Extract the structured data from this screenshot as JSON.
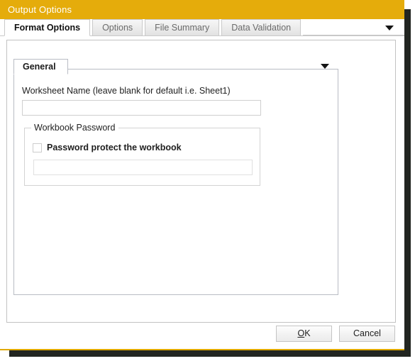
{
  "window": {
    "title": "Output Options",
    "accent_color": "#e5ac0b",
    "background_color": "#ffffff"
  },
  "tabs": [
    {
      "label": "Format Options",
      "active": true
    },
    {
      "label": "Options",
      "active": false
    },
    {
      "label": "File Summary",
      "active": false
    },
    {
      "label": "Data Validation",
      "active": false
    }
  ],
  "tabstrip": {
    "overflow_icon": "chevron-down-icon"
  },
  "general_panel": {
    "title": "General",
    "collapse_icon": "chevron-down-icon",
    "worksheet_name": {
      "label": "Worksheet Name (leave blank for default i.e. Sheet1)",
      "value": "",
      "placeholder": ""
    },
    "workbook_password": {
      "legend": "Workbook Password",
      "checkbox_label": "Password protect the workbook",
      "checked": false,
      "password_value": "",
      "password_placeholder": ""
    }
  },
  "footer": {
    "ok_prefix": "O",
    "ok_suffix": "K",
    "ok_label": "OK",
    "cancel_label": "Cancel"
  }
}
